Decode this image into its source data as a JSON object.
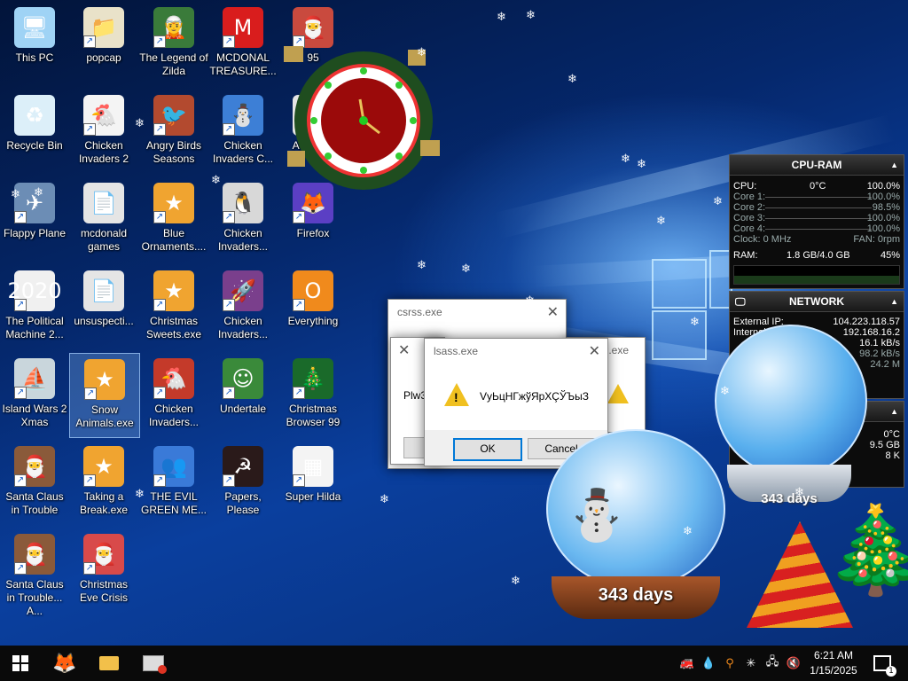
{
  "desktop_icons": [
    {
      "label": "This PC",
      "glyph": "🖥",
      "bg": "#9fd3f5",
      "sc": false
    },
    {
      "label": "popcap",
      "glyph": "📁",
      "bg": "#e9e2c9",
      "sc": true
    },
    {
      "label": "The Legend of Zilda",
      "glyph": "🧝",
      "bg": "#3a7b3a",
      "sc": true
    },
    {
      "label": "MCDONAL TREASURE...",
      "glyph": "M",
      "bg": "#d91d1d",
      "sc": true
    },
    {
      "label": "95",
      "glyph": "🎅",
      "bg": "#c94a3e",
      "sc": true
    },
    {
      "label": "Recycle Bin",
      "glyph": "♻",
      "bg": "#dceff9",
      "sc": false
    },
    {
      "label": "Chicken Invaders 2",
      "glyph": "🐔",
      "bg": "#f4f4f4",
      "sc": true
    },
    {
      "label": "Angry Birds Seasons",
      "glyph": "🐦",
      "bg": "#b34a2f",
      "sc": true
    },
    {
      "label": "Chicken Invaders C...",
      "glyph": "⛄",
      "bg": "#3d7fd6",
      "sc": true
    },
    {
      "label": "Activator",
      "glyph": "📄",
      "bg": "#e5e5e5",
      "sc": false
    },
    {
      "label": "Flappy Plane",
      "glyph": "✈",
      "bg": "#6c8db5",
      "sc": true
    },
    {
      "label": "mcdonald games",
      "glyph": "📄",
      "bg": "#e5e5e5",
      "sc": false
    },
    {
      "label": "Blue Ornaments....",
      "glyph": "★",
      "bg": "#f0a430",
      "sc": true
    },
    {
      "label": "Chicken Invaders...",
      "glyph": "🐧",
      "bg": "#d8d8d8",
      "sc": true
    },
    {
      "label": "Firefox",
      "glyph": "🦊",
      "bg": "#5b3fc4",
      "sc": true
    },
    {
      "label": "The Political Machine 2...",
      "glyph": "2020",
      "bg": "#f0f0f0",
      "sc": true
    },
    {
      "label": "unsuspecti...",
      "glyph": "📄",
      "bg": "#e5e5e5",
      "sc": false
    },
    {
      "label": "Christmas Sweets.exe",
      "glyph": "★",
      "bg": "#f0a430",
      "sc": true
    },
    {
      "label": "Chicken Invaders...",
      "glyph": "🚀",
      "bg": "#7a3f8c",
      "sc": true
    },
    {
      "label": "Everything",
      "glyph": "O",
      "bg": "#f08a1c",
      "sc": true
    },
    {
      "label": "Island Wars 2 Xmas",
      "glyph": "⛵",
      "bg": "#c9d6dc",
      "sc": true
    },
    {
      "label": "Snow Animals.exe",
      "glyph": "★",
      "bg": "#f0a430",
      "sc": true
    },
    {
      "label": "Chicken Invaders...",
      "glyph": "🐔",
      "bg": "#c43a2a",
      "sc": true
    },
    {
      "label": "Undertale",
      "glyph": "☺",
      "bg": "#3a8a3a",
      "sc": true
    },
    {
      "label": "Christmas Browser 99",
      "glyph": "🎄",
      "bg": "#1a6a2a",
      "sc": true
    },
    {
      "label": "Santa Claus in Trouble",
      "glyph": "🎅",
      "bg": "#8a5a3a",
      "sc": true
    },
    {
      "label": "Taking a Break.exe",
      "glyph": "★",
      "bg": "#f0a430",
      "sc": true
    },
    {
      "label": "THE EVIL GREEN ME...",
      "glyph": "👥",
      "bg": "#3a7ad8",
      "sc": true
    },
    {
      "label": "Papers, Please",
      "glyph": "☭",
      "bg": "#2a1a1a",
      "sc": true
    },
    {
      "label": "Super Hilda",
      "glyph": "▦",
      "bg": "#f4f4f4",
      "sc": true
    },
    {
      "label": "Santa Claus in Trouble... A...",
      "glyph": "🎅",
      "bg": "#8a5a3a",
      "sc": true
    },
    {
      "label": "Christmas Eve Crisis",
      "glyph": "🎅",
      "bg": "#d84a4a",
      "sc": true
    }
  ],
  "dialogs": {
    "back": {
      "title": "csrss.exe",
      "text": "Plw3"
    },
    "front": {
      "title": "lsass.exe",
      "message": "VуЬцНГжўЯрХÇЎЪыЗ",
      "ok": "OK",
      "cancel": "Cancel"
    },
    "side": {
      "title": "ne.exe"
    }
  },
  "cpu_ram": {
    "title": "CPU-RAM",
    "cpu_label": "CPU:",
    "cpu_temp": "0°C",
    "cpu_value": "100.0%",
    "cores": [
      {
        "label": "Core 1:",
        "value": "100.0%"
      },
      {
        "label": "Core 2:",
        "value": "98.5%"
      },
      {
        "label": "Core 3:",
        "value": "100.0%"
      },
      {
        "label": "Core 4:",
        "value": "100.0%"
      }
    ],
    "clock": "Clock: 0 MHz",
    "fan": "FAN: 0rpm",
    "ram_label": "RAM:",
    "ram_used": "1.8 GB/4.0 GB",
    "ram_pct": "45%"
  },
  "network": {
    "title": "NETWORK",
    "external_ip_label": "External IP:",
    "external_ip": "104.223.118.57",
    "internal_label": "Internal",
    "internal_ip": "192.168.16.2",
    "down": "16.1 kB/s",
    "up": "98.2 kB/s",
    "total": "24.2 M"
  },
  "third_gadget": {
    "temp": "0°C",
    "size": "9.5 GB",
    "k": "8 K"
  },
  "globes": {
    "small": "343 days",
    "large": "343 days"
  },
  "clock": {
    "time": "6:21 AM",
    "date": "1/15/2025"
  },
  "notification_count": "1",
  "colors": {
    "taskbar": "#0a0a0a",
    "accent": "#0078d7",
    "desktop": "#0a3f9e"
  }
}
